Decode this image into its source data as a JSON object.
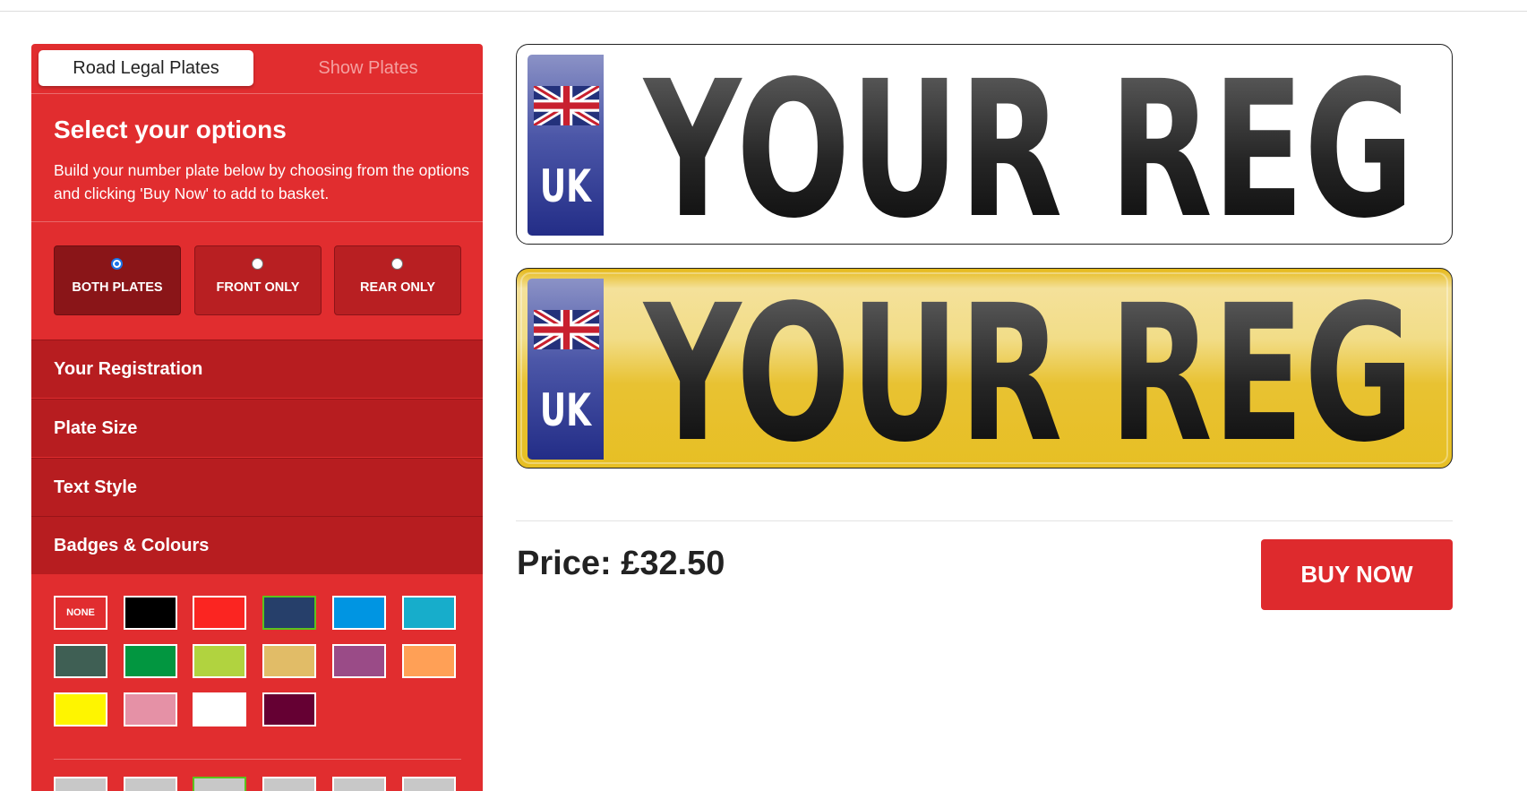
{
  "tabs": {
    "active": "Road Legal Plates",
    "inactive": "Show Plates"
  },
  "options": {
    "title": "Select your options",
    "description": "Build your number plate below by choosing from the options and clicking 'Buy Now' to add to basket."
  },
  "plate_choices": [
    {
      "label": "BOTH PLATES",
      "selected": true
    },
    {
      "label": "FRONT ONLY",
      "selected": false
    },
    {
      "label": "REAR ONLY",
      "selected": false
    }
  ],
  "sections": [
    "Your Registration",
    "Plate Size",
    "Text Style",
    "Badges & Colours"
  ],
  "badge_colours": {
    "none_label": "NONE",
    "swatches": [
      "#000000",
      "#fb2521",
      "#263f6a",
      "#0095e2",
      "#17adcb",
      "#3f5f54",
      "#029640",
      "#b1d33f",
      "#e1bc67",
      "#9a4b87",
      "#ffa056",
      "#fef500",
      "#e591a6",
      "#ffffff",
      "#650033"
    ],
    "selected": "#263f6a"
  },
  "plate": {
    "band_text": "UK",
    "registration": "YOUR REG"
  },
  "price": {
    "label": "Price:",
    "amount": "£32.50"
  },
  "buy_label": "BUY NOW"
}
